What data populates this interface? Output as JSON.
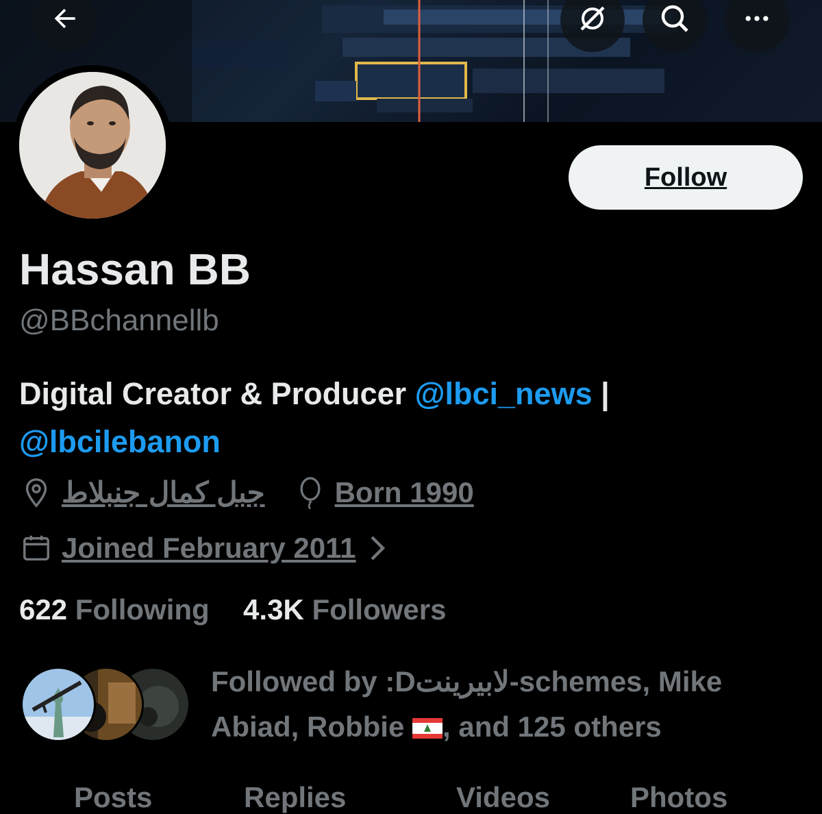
{
  "profile": {
    "name": "Hassan BB",
    "handle": "@BBchannellb",
    "bio_text": "Digital Creator & Producer ",
    "bio_mention1": "@lbci_news",
    "bio_sep": " |",
    "bio_mention2": "@lbcilebanon",
    "location": "جبل كمال جنبلاط",
    "birth": "Born 1990",
    "joined": "Joined February 2011"
  },
  "actions": {
    "follow_label": "Follow"
  },
  "stats": {
    "following_count": "622",
    "following_label": "Following",
    "followers_count": "4.3K",
    "followers_label": "Followers"
  },
  "followed_by": {
    "prefix": "Followed by :D",
    "names1": "لابيرينت-schemes, Mike",
    "names2a": "Abiad, Robbie ",
    "names2b": ", and 125 others"
  },
  "tabs": [
    "Posts",
    "Replies",
    "Videos",
    "Photos"
  ],
  "colors": {
    "accent": "#1d9bf0",
    "muted": "#71767b",
    "text": "#e7e9ea",
    "background": "#000000"
  },
  "icons": [
    "back-arrow-icon",
    "grok-icon",
    "search-icon",
    "more-icon",
    "location-icon",
    "balloon-icon",
    "calendar-icon",
    "chevron-right-icon"
  ]
}
